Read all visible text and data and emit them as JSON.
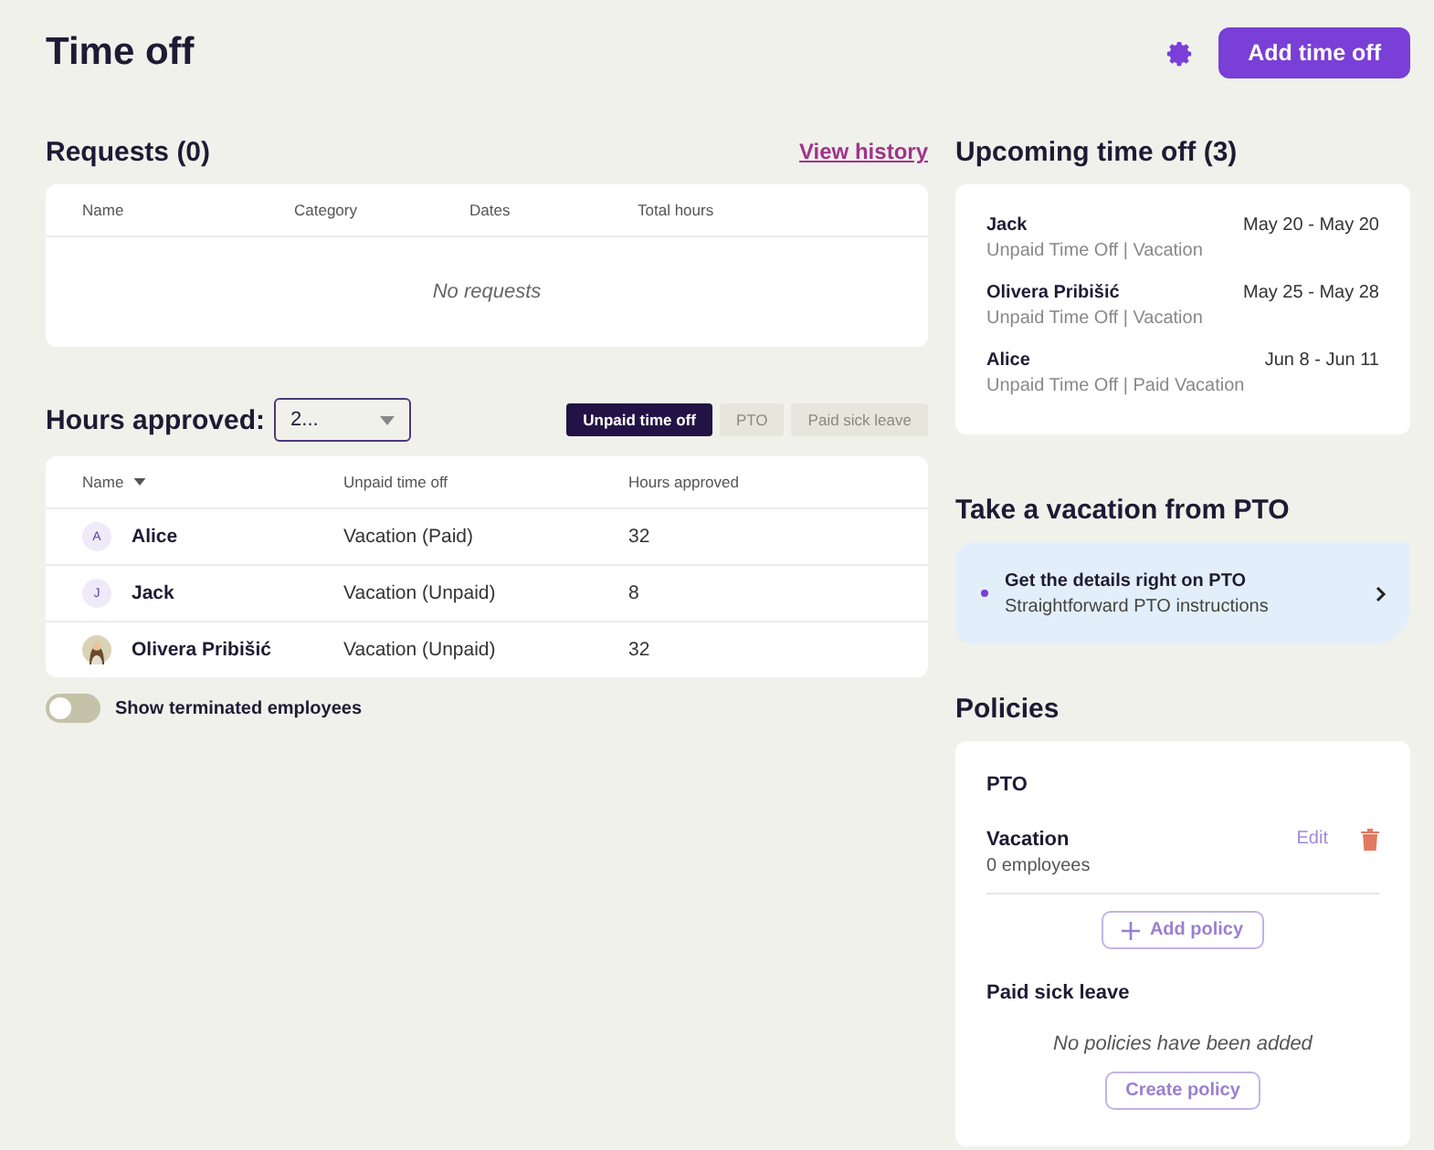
{
  "page": {
    "title": "Time off",
    "primary_action": "Add time off"
  },
  "requests": {
    "heading": "Requests (0)",
    "link": "View history",
    "columns": [
      "Name",
      "Category",
      "Dates",
      "Total hours"
    ],
    "empty": "No requests"
  },
  "hours_approved": {
    "heading": "Hours approved:",
    "select_value": "2...",
    "filters": [
      {
        "label": "Unpaid time off",
        "selected": true
      },
      {
        "label": "PTO",
        "selected": false
      },
      {
        "label": "Paid sick leave",
        "selected": false
      }
    ],
    "columns": [
      {
        "label": "Name",
        "sort_descending": true
      },
      {
        "label": "Unpaid time off"
      },
      {
        "label": "Hours approved"
      }
    ],
    "rows": [
      {
        "avatar": {
          "kind": "initial",
          "text": "A"
        },
        "name": "Alice",
        "category": "Vacation (Paid)",
        "hours": "32"
      },
      {
        "avatar": {
          "kind": "initial",
          "text": "J"
        },
        "name": "Jack",
        "category": "Vacation (Unpaid)",
        "hours": "8"
      },
      {
        "name": "Olivera Pribišić",
        "category": "Vacation (Unpaid)",
        "hours": "32"
      }
    ],
    "toggle": {
      "label": "Show terminated employees",
      "on": false
    }
  },
  "upcoming": {
    "heading": "Upcoming time off (3)",
    "items": [
      {
        "name": "Jack",
        "detail": "Unpaid Time Off | Vacation",
        "dates": "May 20 - May 20"
      },
      {
        "name": "Olivera Pribišić",
        "detail": "Unpaid Time Off | Vacation",
        "dates": "May 25 - May 28"
      },
      {
        "name": "Alice",
        "detail": "Unpaid Time Off | Paid Vacation",
        "dates": "Jun 8 - Jun 11"
      }
    ]
  },
  "vacation": {
    "heading": "Take a vacation from PTO",
    "title": "Get the details right on PTO",
    "subtitle": "Straightforward PTO instructions"
  },
  "policies": {
    "heading": "Policies",
    "groups": [
      {
        "title": "PTO",
        "policies": [
          {
            "name": "Vacation",
            "detail": "0 employees",
            "edit": "Edit"
          }
        ],
        "button": "Add policy",
        "kind": "add"
      },
      {
        "title": "Paid sick leave",
        "empty": "No policies have been added",
        "button": "Create policy",
        "kind": "create"
      }
    ]
  }
}
